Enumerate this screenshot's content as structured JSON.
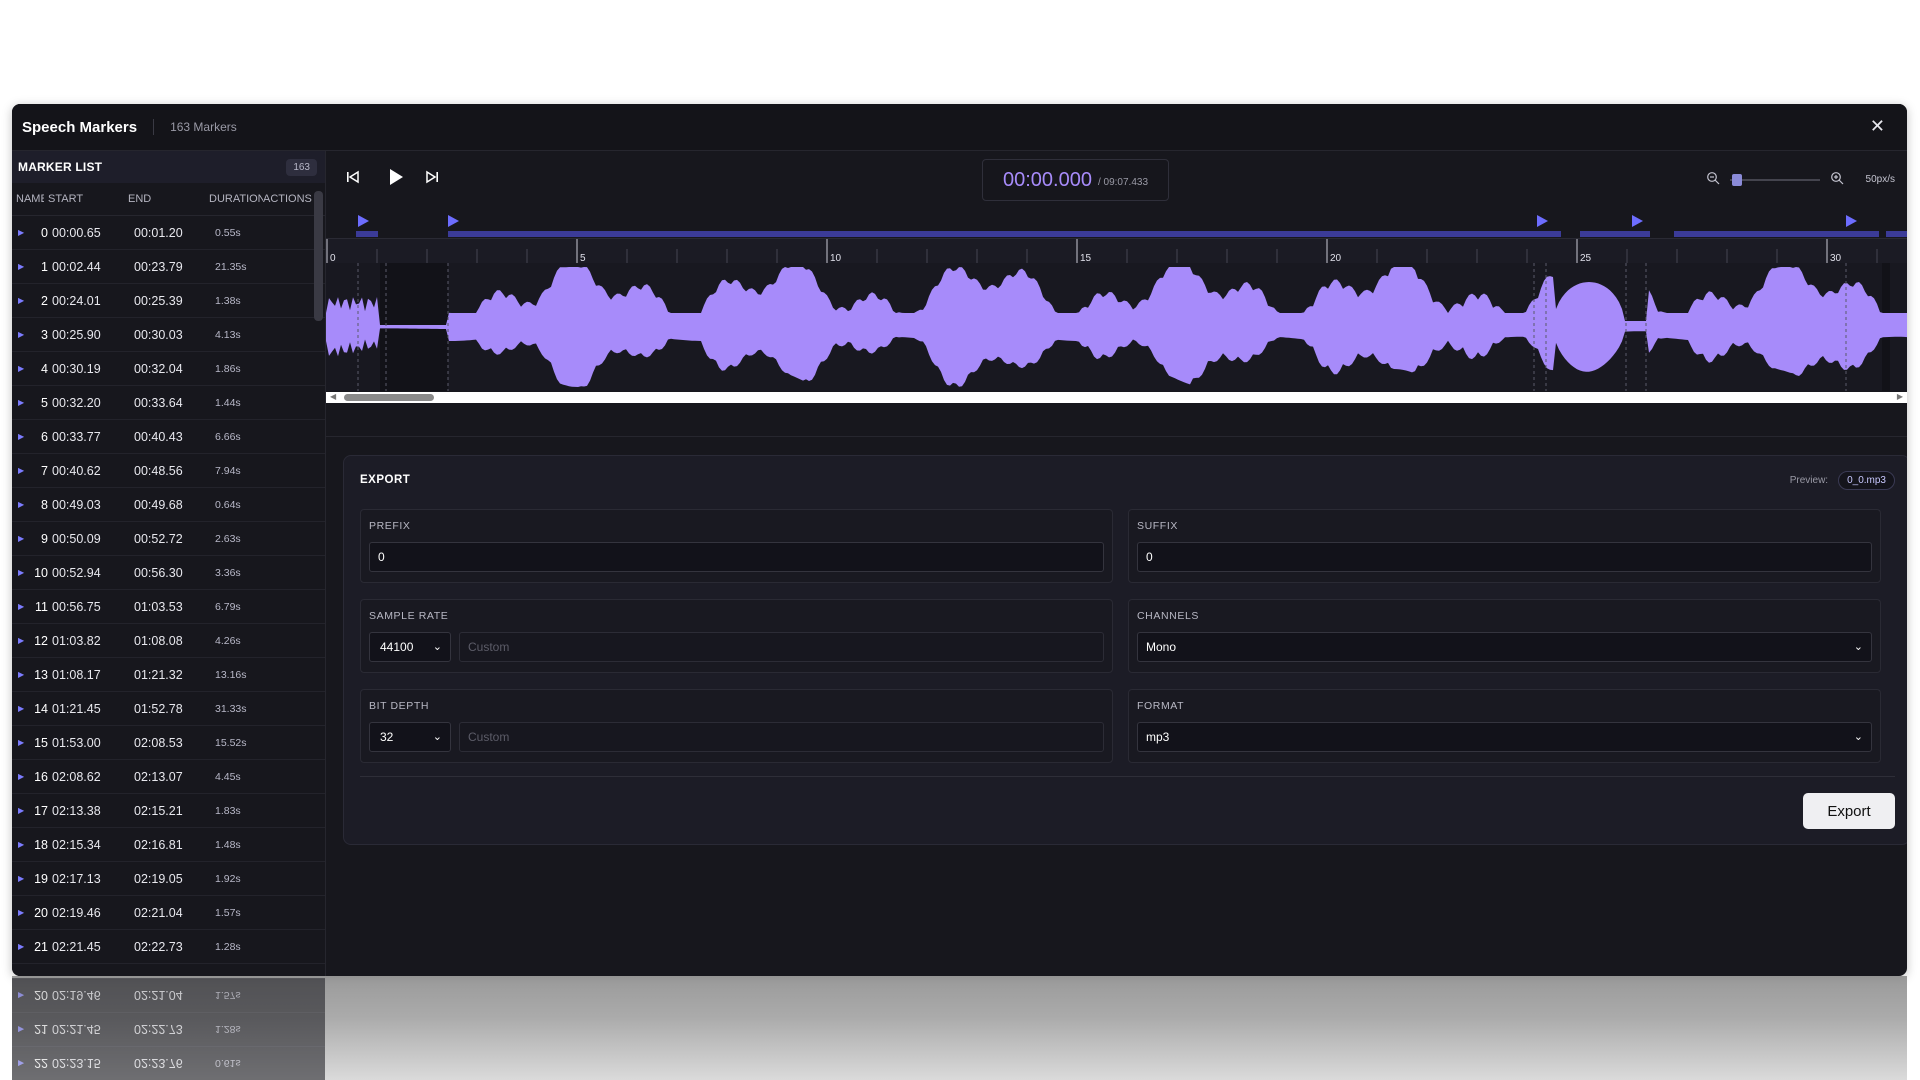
{
  "window": {
    "title": "Speech Markers",
    "subtitle": "163 Markers",
    "close_label": "✕"
  },
  "sidebar": {
    "heading": "MARKER LIST",
    "count": "163",
    "columns": {
      "name": "NAME",
      "start": "START",
      "end": "END",
      "duration": "DURATION",
      "actions": "ACTIONS"
    },
    "rows": [
      {
        "idx": "0",
        "start": "00:00.65",
        "end": "00:01.20",
        "dur": "0.55s"
      },
      {
        "idx": "1",
        "start": "00:02.44",
        "end": "00:23.79",
        "dur": "21.35s"
      },
      {
        "idx": "2",
        "start": "00:24.01",
        "end": "00:25.39",
        "dur": "1.38s"
      },
      {
        "idx": "3",
        "start": "00:25.90",
        "end": "00:30.03",
        "dur": "4.13s"
      },
      {
        "idx": "4",
        "start": "00:30.19",
        "end": "00:32.04",
        "dur": "1.86s"
      },
      {
        "idx": "5",
        "start": "00:32.20",
        "end": "00:33.64",
        "dur": "1.44s"
      },
      {
        "idx": "6",
        "start": "00:33.77",
        "end": "00:40.43",
        "dur": "6.66s"
      },
      {
        "idx": "7",
        "start": "00:40.62",
        "end": "00:48.56",
        "dur": "7.94s"
      },
      {
        "idx": "8",
        "start": "00:49.03",
        "end": "00:49.68",
        "dur": "0.64s"
      },
      {
        "idx": "9",
        "start": "00:50.09",
        "end": "00:52.72",
        "dur": "2.63s"
      },
      {
        "idx": "10",
        "start": "00:52.94",
        "end": "00:56.30",
        "dur": "3.36s"
      },
      {
        "idx": "11",
        "start": "00:56.75",
        "end": "01:03.53",
        "dur": "6.79s"
      },
      {
        "idx": "12",
        "start": "01:03.82",
        "end": "01:08.08",
        "dur": "4.26s"
      },
      {
        "idx": "13",
        "start": "01:08.17",
        "end": "01:21.32",
        "dur": "13.16s"
      },
      {
        "idx": "14",
        "start": "01:21.45",
        "end": "01:52.78",
        "dur": "31.33s"
      },
      {
        "idx": "15",
        "start": "01:53.00",
        "end": "02:08.53",
        "dur": "15.52s"
      },
      {
        "idx": "16",
        "start": "02:08.62",
        "end": "02:13.07",
        "dur": "4.45s"
      },
      {
        "idx": "17",
        "start": "02:13.38",
        "end": "02:15.21",
        "dur": "1.83s"
      },
      {
        "idx": "18",
        "start": "02:15.34",
        "end": "02:16.81",
        "dur": "1.48s"
      },
      {
        "idx": "19",
        "start": "02:17.13",
        "end": "02:19.05",
        "dur": "1.92s"
      },
      {
        "idx": "20",
        "start": "02:19.46",
        "end": "02:21.04",
        "dur": "1.57s"
      },
      {
        "idx": "21",
        "start": "02:21.45",
        "end": "02:22.73",
        "dur": "1.28s"
      },
      {
        "idx": "22",
        "start": "02:23.15",
        "end": "02:23.76",
        "dur": "0.61s"
      }
    ]
  },
  "transport": {
    "current_time": "00:00.000",
    "total_time": "/ 09:07.433",
    "zoom_label": "50px/s"
  },
  "ruler_labels": [
    "0",
    "5",
    "10",
    "15",
    "20",
    "25",
    "30"
  ],
  "export": {
    "heading": "EXPORT",
    "preview_label": "Preview:",
    "preview_value": "0_0.mp3",
    "prefix": {
      "label": "PREFIX",
      "value": "0"
    },
    "suffix": {
      "label": "SUFFIX",
      "value": "0"
    },
    "sample_rate": {
      "label": "SAMPLE RATE",
      "value": "44100",
      "custom_placeholder": "Custom"
    },
    "channels": {
      "label": "CHANNELS",
      "value": "Mono"
    },
    "bit_depth": {
      "label": "BIT DEPTH",
      "value": "32",
      "custom_placeholder": "Custom"
    },
    "format": {
      "label": "FORMAT",
      "value": "mp3"
    },
    "button_label": "Export"
  },
  "colors": {
    "accent": "#7c7cff",
    "waveform": "#a78bfa",
    "background": "#17171d"
  }
}
